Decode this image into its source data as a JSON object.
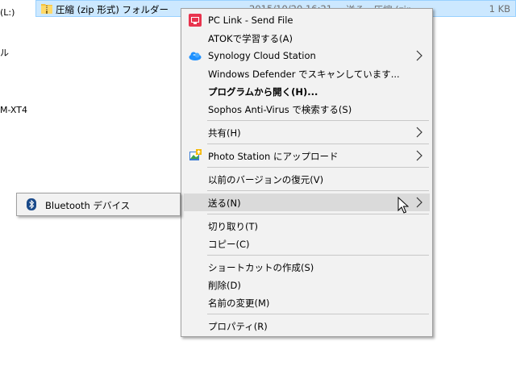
{
  "explorer": {
    "left_fragments": [
      "(L:)",
      "ル",
      "M-XT4"
    ],
    "selected_file": {
      "name": "圧縮 (zip 形式) フォルダー",
      "date": "2015/10/20 16:21",
      "type": "送る　圧縮 (zip",
      "size": "1 KB"
    }
  },
  "context_menu": {
    "items": [
      {
        "label": "PC Link - Send File",
        "icon": "pc-link-icon"
      },
      {
        "label": "ATOKで学習する(A)"
      },
      {
        "label": "Synology Cloud Station",
        "icon": "cloud-icon",
        "submenu": true
      },
      {
        "label": "Windows Defender でスキャンしています..."
      },
      {
        "label": "プログラムから開く(H)...",
        "bold": true
      },
      {
        "label": "Sophos Anti-Virus で検索する(S)"
      },
      {
        "label": "共有(H)",
        "submenu": true
      },
      {
        "label": "Photo Station にアップロード",
        "icon": "photo-station-icon",
        "submenu": true
      },
      {
        "label": "以前のバージョンの復元(V)"
      },
      {
        "label": "送る(N)",
        "submenu": true,
        "active": true
      },
      {
        "label": "切り取り(T)"
      },
      {
        "label": "コピー(C)"
      },
      {
        "label": "ショートカットの作成(S)"
      },
      {
        "label": "削除(D)"
      },
      {
        "label": "名前の変更(M)"
      },
      {
        "label": "プロパティ(R)"
      }
    ]
  },
  "send_to_submenu": {
    "items": [
      {
        "label": "Bluetooth デバイス",
        "icon": "bluetooth-icon"
      }
    ]
  },
  "colors": {
    "selection": "#cce8ff",
    "menu_bg": "#f2f2f2",
    "menu_hover": "#dadada",
    "pc_link_red": "#e8344e",
    "cloud_blue": "#1e90ff"
  }
}
